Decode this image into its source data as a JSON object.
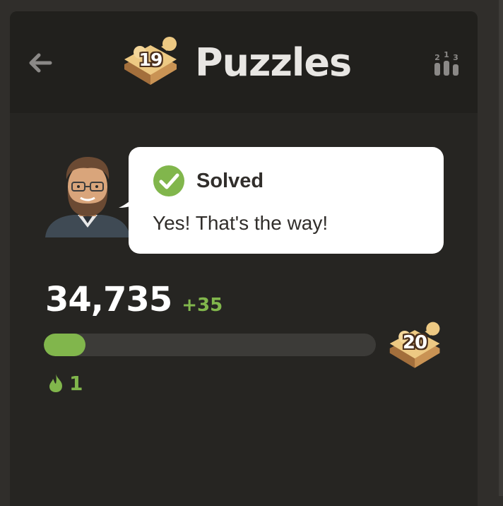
{
  "header": {
    "title": "Puzzles",
    "level_badge": "19",
    "back_icon": "arrow-left-icon",
    "leaderboard_icon": "leaderboard-podium-icon",
    "leaderboard_digits": [
      "2",
      "1",
      "3"
    ]
  },
  "feedback": {
    "status_icon": "check-circle-icon",
    "status": "Solved",
    "message": "Yes! That's the way!"
  },
  "rating": {
    "value": "34,735",
    "delta": "+35"
  },
  "progress": {
    "fill_fraction": 0.125,
    "next_level_badge": "20"
  },
  "streak": {
    "icon": "flame-icon",
    "count": "1"
  },
  "colors": {
    "accent_green": "#81b64c",
    "panel_bg": "#262522",
    "header_bg": "#21201d",
    "bar_track": "#3c3b38",
    "puzzle_gold": "#e9c37b"
  }
}
